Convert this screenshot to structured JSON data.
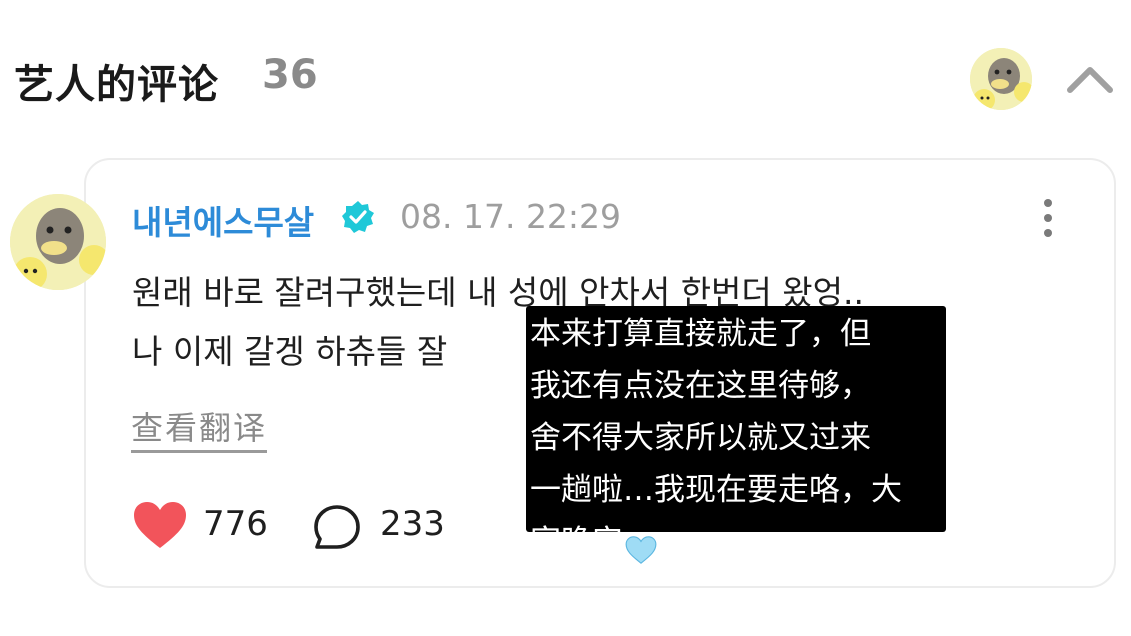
{
  "header": {
    "title": "艺人的评论",
    "count": "36",
    "avatar_icon": "duck-avatar-icon",
    "collapse_icon": "chevron-up-icon"
  },
  "comment": {
    "author": "내년에스무살",
    "verified_icon": "verified-badge-icon",
    "timestamp": "08. 17. 22:29",
    "body_line1": "원래 바로 잘려구했는데 내 성에 안차서 한번더 왔엉..",
    "body_line2": "나 이제 갈겡 하츄들 잘",
    "translate_label": "查看翻译",
    "likes": "776",
    "replies": "233",
    "more_icon": "more-vertical-icon",
    "like_icon": "heart-icon",
    "reply_icon": "comment-bubble-icon"
  },
  "translation_overlay": {
    "lines": [
      "本来打算直接就走了，但",
      "我还有点没在这里待够，",
      "舍不得大家所以就又过来",
      "一趟啦…我现在要走咯，大",
      "家晚安"
    ],
    "emoji_icon": "light-blue-heart-icon"
  },
  "colors": {
    "accent_blue": "#2d8bd8",
    "verified_teal": "#1fc8d8",
    "heart_red": "#f2545b",
    "muted_gray": "#8a8a8a"
  }
}
